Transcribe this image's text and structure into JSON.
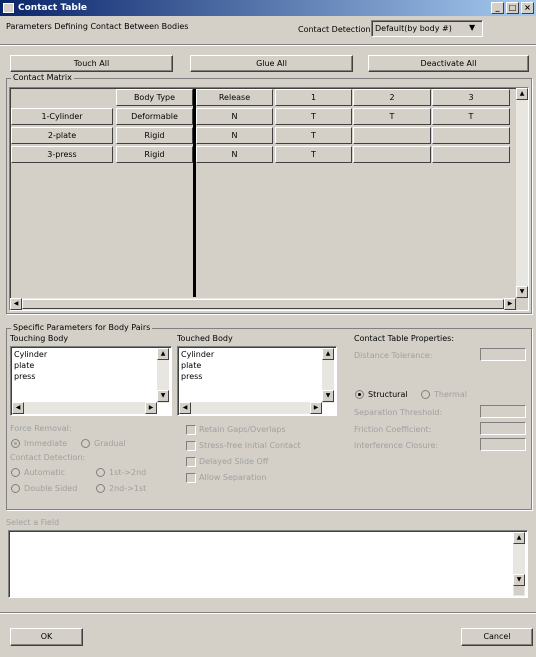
{
  "window": {
    "title": "Contact Table"
  },
  "header": {
    "description": "Parameters Defining Contact Between Bodies",
    "detection_label": "Contact Detection:",
    "detection_value": "Default(by body #)"
  },
  "toolbar": {
    "touch_all": "Touch All",
    "glue_all": "Glue All",
    "deactivate_all": "Deactivate All"
  },
  "matrix": {
    "group_label": "Contact Matrix",
    "headers": {
      "body_type": "Body Type",
      "release": "Release",
      "c1": "1",
      "c2": "2",
      "c3": "3"
    },
    "rows": [
      {
        "name": "1-Cylinder",
        "type": "Deformable",
        "release": "N",
        "c1": "T",
        "c2": "T",
        "c3": "T"
      },
      {
        "name": "2-plate",
        "type": "Rigid",
        "release": "N",
        "c1": "T",
        "c2": "",
        "c3": ""
      },
      {
        "name": "3-press",
        "type": "Rigid",
        "release": "N",
        "c1": "T",
        "c2": "",
        "c3": ""
      }
    ]
  },
  "pairs": {
    "group_label": "Specific Parameters for Body Pairs",
    "touching_label": "Touching Body",
    "touched_label": "Touched Body",
    "touching_items": [
      "Cylinder",
      "plate",
      "press"
    ],
    "touched_items": [
      "Cylinder",
      "plate",
      "press"
    ],
    "force_removal_label": "Force Removal:",
    "immediate": "Immediate",
    "gradual": "Gradual",
    "detection_label": "Contact Detection:",
    "automatic": "Automatic",
    "first_second": "1st->2nd",
    "double_sided": "Double Sided",
    "second_first": "2nd->1st",
    "retain_gaps": "Retain Gaps/Overlaps",
    "stress_free": "Stress-free Initial Contact",
    "delayed_slide": "Delayed Slide Off",
    "allow_separation": "Allow Separation",
    "props_label": "Contact Table Properties:",
    "distance_tolerance": "Distance Tolerance:",
    "structural": "Structural",
    "thermal": "Thermal",
    "separation_threshold": "Separation Threshold:",
    "friction_coefficient": "Friction Coefficient:",
    "interference_closure": "Interference Closure:"
  },
  "field": {
    "label": "Select a Field"
  },
  "footer": {
    "ok": "OK",
    "cancel": "Cancel"
  }
}
